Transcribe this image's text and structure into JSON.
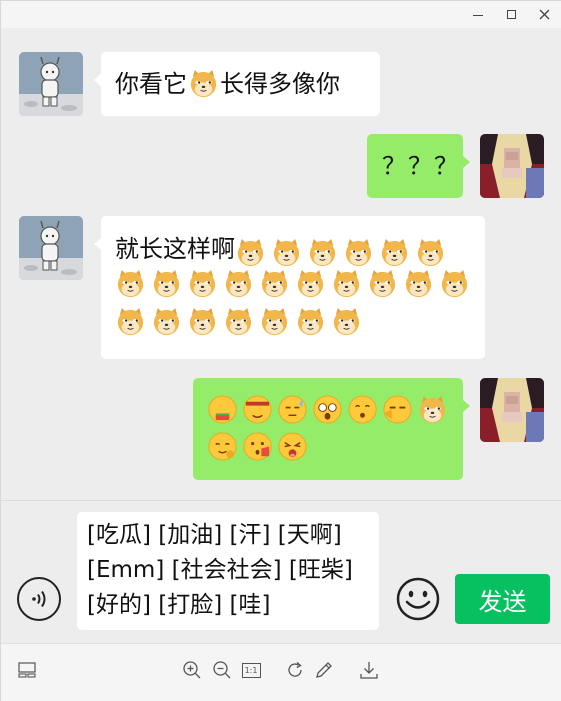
{
  "window": {
    "controls": [
      "minimize-icon",
      "maximize-icon",
      "close-icon"
    ]
  },
  "messages": [
    {
      "side": "left",
      "avatar": "astronaut-avatar",
      "text_before": "你看它",
      "emoji": "doge",
      "text_after": "长得多像你"
    },
    {
      "side": "right",
      "avatar": "blurred-photo-avatar",
      "text": "？？？"
    },
    {
      "side": "left",
      "avatar": "astronaut-avatar",
      "text": "就长这样啊",
      "doge_count": 23
    },
    {
      "side": "right",
      "avatar": "blurred-photo-avatar",
      "emojis": [
        "吃瓜",
        "加油",
        "汗",
        "天啊",
        "Emm",
        "社会社会",
        "旺柴",
        "好的",
        "打脸",
        "哇"
      ]
    }
  ],
  "input": {
    "text": "[吃瓜] [加油] [汗] [天啊] [Emm] [社会社会] [旺柴] [好的] [打脸] [哇]"
  },
  "send_label": "发送",
  "toolbar": {
    "icons": [
      "layout-icon",
      "zoom-in-icon",
      "zoom-out-icon",
      "actual-size-icon",
      "rotate-icon",
      "edit-icon",
      "download-icon"
    ],
    "actual_size_label": "1:1"
  },
  "colors": {
    "accent": "#07c160",
    "bubble_right": "#95ec69",
    "bubble_left": "#ffffff",
    "background": "#ededed"
  }
}
